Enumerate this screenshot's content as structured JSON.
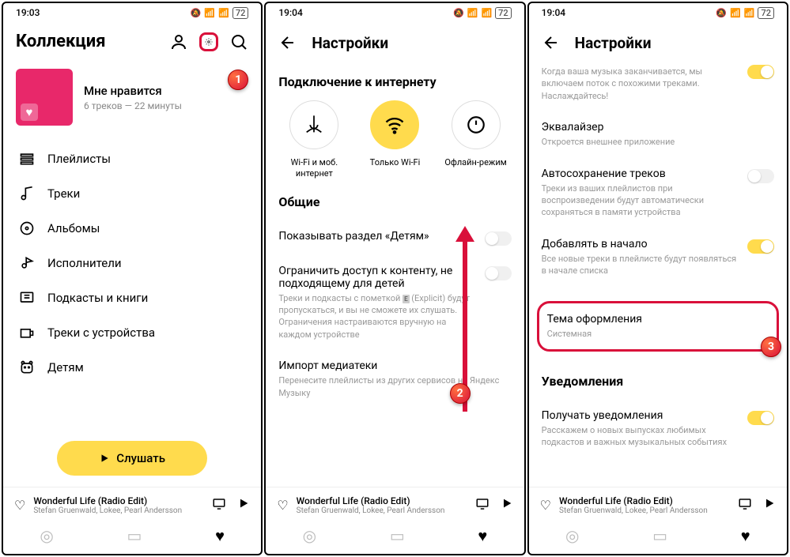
{
  "status": {
    "time1": "19:03",
    "time2": "19:04",
    "time3": "19:04",
    "battery": "72"
  },
  "s1": {
    "title": "Коллекция",
    "liked": {
      "title": "Мне нравится",
      "sub": "6 треков — 22 минуты"
    },
    "menu": [
      {
        "label": "Плейлисты"
      },
      {
        "label": "Треки"
      },
      {
        "label": "Альбомы"
      },
      {
        "label": "Исполнители"
      },
      {
        "label": "Подкасты и книги"
      },
      {
        "label": "Треки с устройства"
      },
      {
        "label": "Детям"
      }
    ],
    "listen": "Слушать"
  },
  "s2": {
    "title": "Настройки",
    "sec_conn": "Подключение к интернету",
    "conn": [
      {
        "label": "Wi-Fi и моб. интернет"
      },
      {
        "label": "Только Wi-Fi"
      },
      {
        "label": "Офлайн-режим"
      }
    ],
    "sec_general": "Общие",
    "kids_section": "Показывать раздел «Детям»",
    "restrict_title": "Ограничить доступ к контенту, не подходящему для детей",
    "restrict_desc1": "Треки и подкасты с пометкой ",
    "restrict_desc2": " (Explicit) будут пропускаться, и вы не сможете их слушать. Ограничения настраиваются вручную на каждом устройстве",
    "import_title": "Импорт медиатеки",
    "import_desc": "Перенесите плейлисты из других сервисов на Яндекс Музыку"
  },
  "s3": {
    "title": "Настройки",
    "top_desc": "Когда ваша музыка заканчивается, мы включаем поток с похожими треками. Наслаждайтесь!",
    "eq_title": "Эквалайзер",
    "eq_desc": "Откроется внешнее приложение",
    "autosave_title": "Автосохранение треков",
    "autosave_desc": "Треки из ваших плейлистов при воспроизведении будут автоматически сохраняться в памяти устройства",
    "addstart_title": "Добавлять в начало",
    "addstart_desc": "Все новые треки в плейлисте будут появляться в начале списка",
    "theme_title": "Тема оформления",
    "theme_value": "Системная",
    "notif_section": "Уведомления",
    "recv_title": "Получать уведомления",
    "recv_desc": "Расскажем о новых выпусках любимых подкастов и важных музыкальных событиях"
  },
  "np": {
    "title": "Wonderful Life (Radio Edit)",
    "artist": "Stefan Gruenwald, Lokee, Pearl Andersson"
  }
}
